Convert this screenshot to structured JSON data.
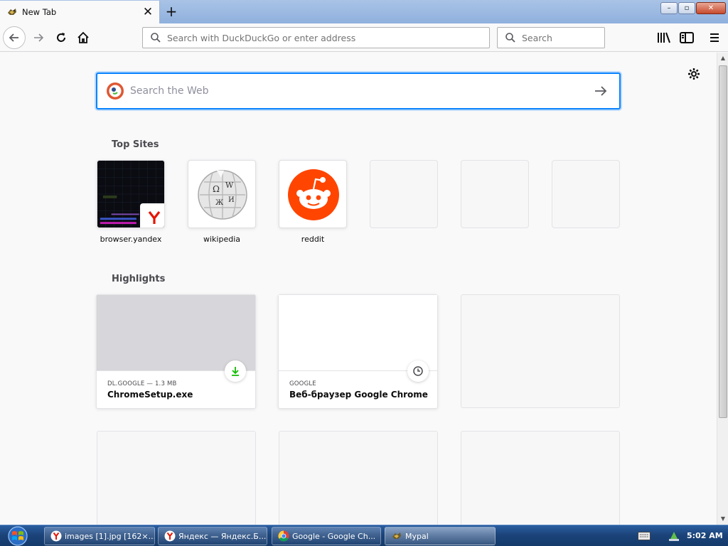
{
  "tab": {
    "title": "New Tab",
    "close_glyph": "✕",
    "new_tab_glyph": "+"
  },
  "window_controls": {
    "minimize": "–",
    "maximize": "▫",
    "close": "✕"
  },
  "navbar": {
    "url_placeholder": "Search with DuckDuckGo or enter address",
    "search_placeholder": "Search"
  },
  "web_search": {
    "placeholder": "Search the Web"
  },
  "top_sites": {
    "title": "Top Sites",
    "sites": [
      {
        "label": "browser.yandex"
      },
      {
        "label": "wikipedia"
      },
      {
        "label": "reddit"
      }
    ]
  },
  "highlights": {
    "title": "Highlights",
    "cards": [
      {
        "source": "DL.GOOGLE — 1.3 MB",
        "title": "ChromeSetup.exe",
        "badge_icon": "download-icon"
      },
      {
        "source": "GOOGLE",
        "title": "Веб-браузер Google Chrome",
        "badge_icon": "clock-icon"
      }
    ]
  },
  "taskbar": {
    "items": [
      {
        "label": "images [1].jpg [162×...",
        "icon": "yandex-browser-icon"
      },
      {
        "label": "Яндекс — Яндекс.Б...",
        "icon": "yandex-browser-icon"
      },
      {
        "label": "Google - Google Ch...",
        "icon": "chrome-icon"
      },
      {
        "label": "Mypal",
        "icon": "mypal-icon"
      }
    ],
    "clock": "5:02 AM"
  },
  "colors": {
    "accent": "#0a84ff",
    "reddit": "#ff4500",
    "yandex": "#e61400",
    "download": "#12bc00"
  }
}
